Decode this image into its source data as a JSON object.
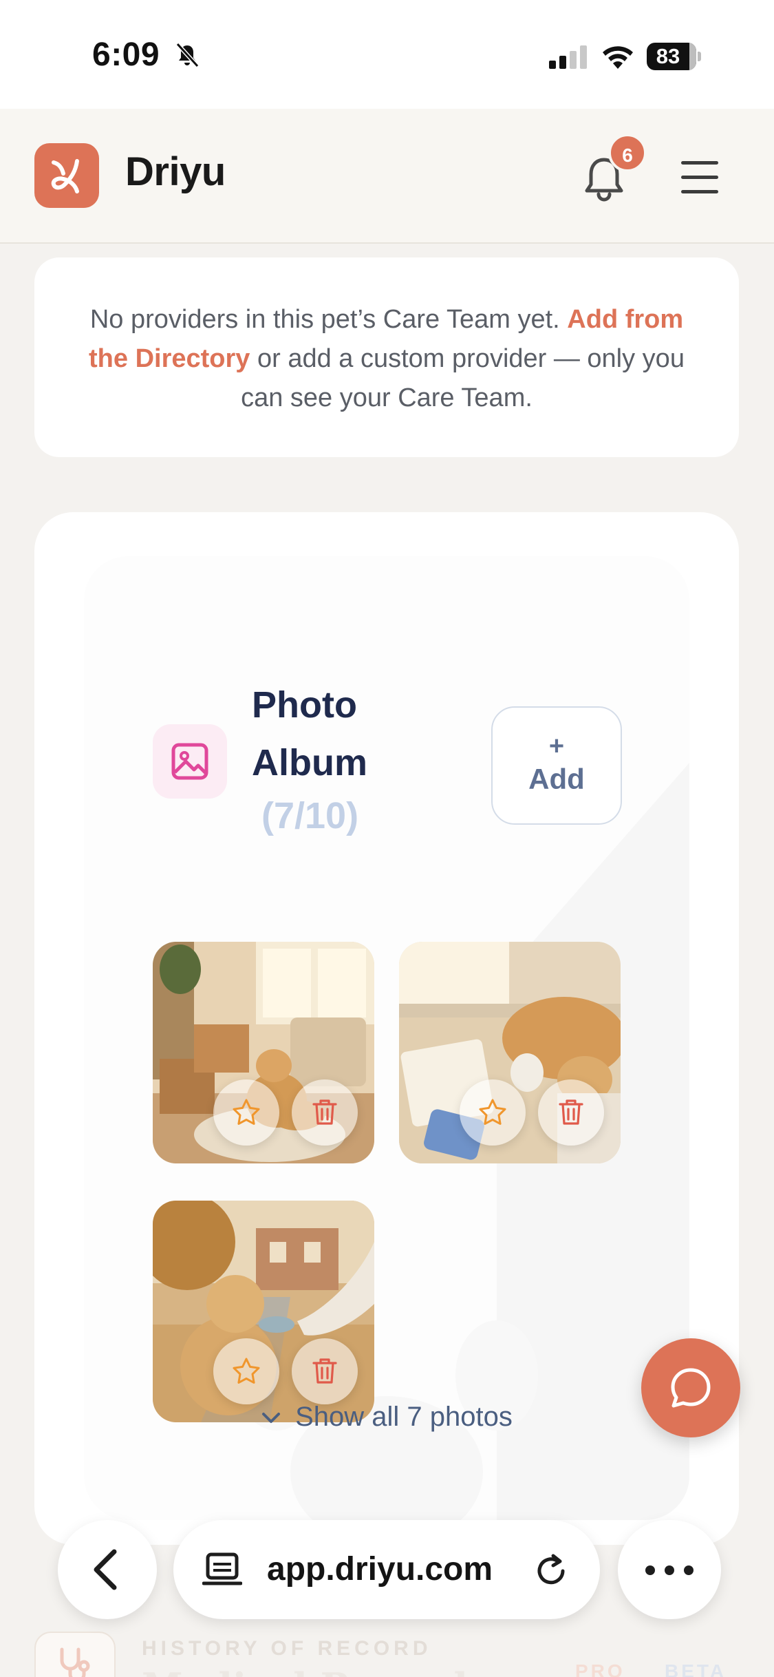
{
  "status_bar": {
    "time": "6:09",
    "battery": "83",
    "icons": [
      "bell-slash-icon",
      "signal-icon",
      "wifi-icon",
      "battery-icon"
    ]
  },
  "header": {
    "brand": "Driyu",
    "notification_count": "6",
    "icons": [
      "logo-icon",
      "bell-icon",
      "hamburger-menu-icon"
    ]
  },
  "care_team": {
    "text_before": "No providers in this pet’s Care Team yet.",
    "link_text": "Add from the Directory",
    "text_after": "or add a custom provider — only you can see your Care Team."
  },
  "album": {
    "title": "Photo Album",
    "count": "(7/10)",
    "add_plus": "+",
    "add_label": "Add",
    "photos": [
      {
        "subject": "golden retriever lying by moving boxes in a sunny living room"
      },
      {
        "subject": "golden retriever sleeping beside a notebook, mug and phone"
      },
      {
        "subject": "golden retriever receiving a bowl on an autumn sidewalk"
      }
    ],
    "show_all": "Show all 7 photos",
    "colors": {
      "accent": "#dd7357",
      "title": "#1f2a4d",
      "count": "#c2d0e6",
      "star": "#f0962c",
      "trash": "#e05a4a"
    }
  },
  "peek": {
    "label": "HISTORY OF RECORD",
    "title": "Medical Records",
    "pro": "PRO",
    "beta": "BETA"
  },
  "browser": {
    "url": "app.driyu.com",
    "icons": [
      "back-chevron-icon",
      "tab-icon",
      "reload-icon",
      "more-icon"
    ]
  }
}
